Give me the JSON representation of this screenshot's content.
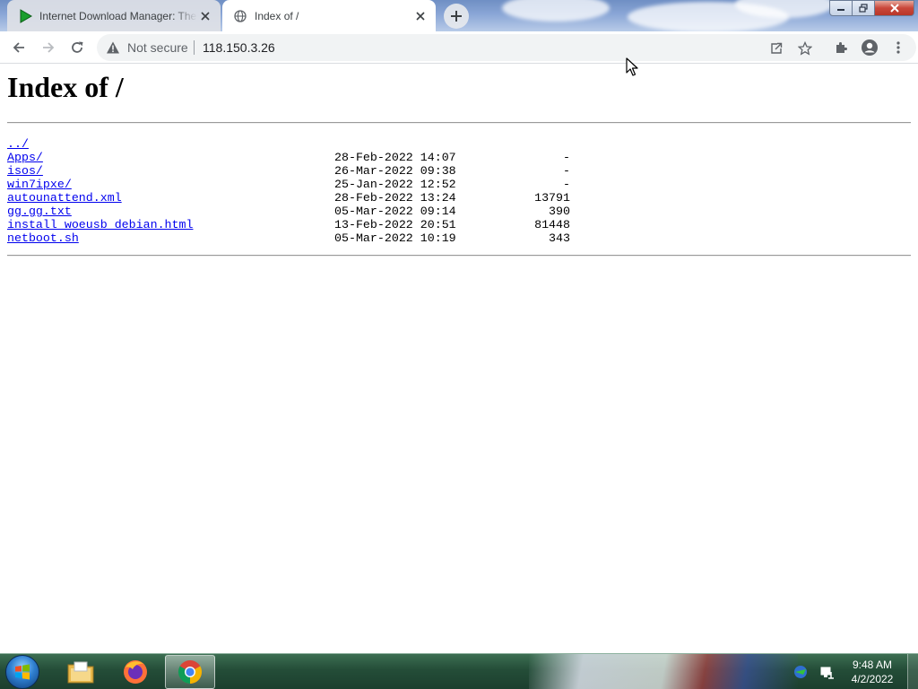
{
  "browser": {
    "tabs": [
      {
        "title": "Internet Download Manager: The",
        "icon": "idm-play-icon"
      },
      {
        "title": "Index of /",
        "icon": "globe-icon"
      }
    ],
    "address": {
      "security_label": "Not secure",
      "url": "118.150.3.26"
    }
  },
  "page": {
    "title": "Index of /",
    "parent_link": "../",
    "entries": [
      {
        "name": "Apps/",
        "date": "28-Feb-2022 14:07",
        "size": "-"
      },
      {
        "name": "isos/",
        "date": "26-Mar-2022 09:38",
        "size": "-"
      },
      {
        "name": "win7ipxe/",
        "date": "25-Jan-2022 12:52",
        "size": "-"
      },
      {
        "name": "autounattend.xml",
        "date": "28-Feb-2022 13:24",
        "size": "13791"
      },
      {
        "name": "gg.gg.txt",
        "date": "05-Mar-2022 09:14",
        "size": "390"
      },
      {
        "name": "install_woeusb_debian.html",
        "date": "13-Feb-2022 20:51",
        "size": "81448"
      },
      {
        "name": "netboot.sh",
        "date": "05-Mar-2022 10:19",
        "size": "343"
      }
    ]
  },
  "taskbar": {
    "apps": [
      "file-explorer-icon",
      "firefox-icon",
      "chrome-icon"
    ],
    "clock": {
      "time": "9:48 AM",
      "date": "4/2/2022"
    }
  },
  "colors": {
    "link": "#0000ee",
    "omnibox_bg": "#f1f3f4",
    "taskbar": "#244d38"
  }
}
